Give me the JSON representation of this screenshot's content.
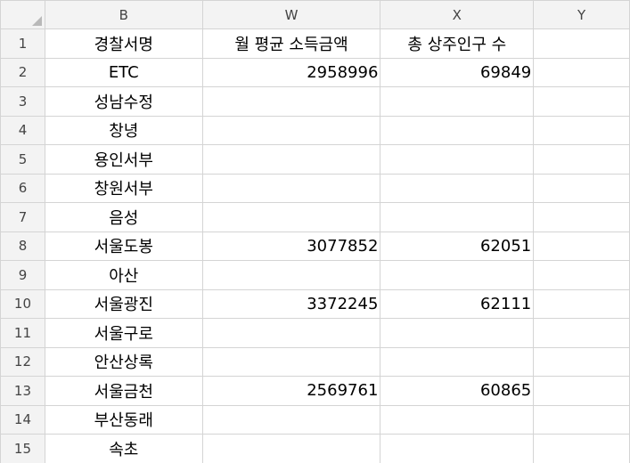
{
  "columns": [
    "B",
    "W",
    "X",
    "Y"
  ],
  "rows": [
    {
      "row": "1",
      "B": "경찰서명",
      "W": "월 평균 소득금액",
      "X": "총 상주인구 수",
      "Y": ""
    },
    {
      "row": "2",
      "B": "ETC",
      "W": "2958996",
      "X": "69849",
      "Y": ""
    },
    {
      "row": "3",
      "B": "성남수정",
      "W": "",
      "X": "",
      "Y": ""
    },
    {
      "row": "4",
      "B": "창녕",
      "W": "",
      "X": "",
      "Y": ""
    },
    {
      "row": "5",
      "B": "용인서부",
      "W": "",
      "X": "",
      "Y": ""
    },
    {
      "row": "6",
      "B": "창원서부",
      "W": "",
      "X": "",
      "Y": ""
    },
    {
      "row": "7",
      "B": "음성",
      "W": "",
      "X": "",
      "Y": ""
    },
    {
      "row": "8",
      "B": "서울도봉",
      "W": "3077852",
      "X": "62051",
      "Y": ""
    },
    {
      "row": "9",
      "B": "아산",
      "W": "",
      "X": "",
      "Y": ""
    },
    {
      "row": "10",
      "B": "서울광진",
      "W": "3372245",
      "X": "62111",
      "Y": ""
    },
    {
      "row": "11",
      "B": "서울구로",
      "W": "",
      "X": "",
      "Y": ""
    },
    {
      "row": "12",
      "B": "안산상록",
      "W": "",
      "X": "",
      "Y": ""
    },
    {
      "row": "13",
      "B": "서울금천",
      "W": "2569761",
      "X": "60865",
      "Y": ""
    },
    {
      "row": "14",
      "B": "부산동래",
      "W": "",
      "X": "",
      "Y": ""
    },
    {
      "row": "15",
      "B": "속초",
      "W": "",
      "X": "",
      "Y": ""
    }
  ],
  "colors": {
    "header_bg": "#f3f3f3",
    "gridline": "#d4d4d4",
    "header_text": "#444444"
  }
}
